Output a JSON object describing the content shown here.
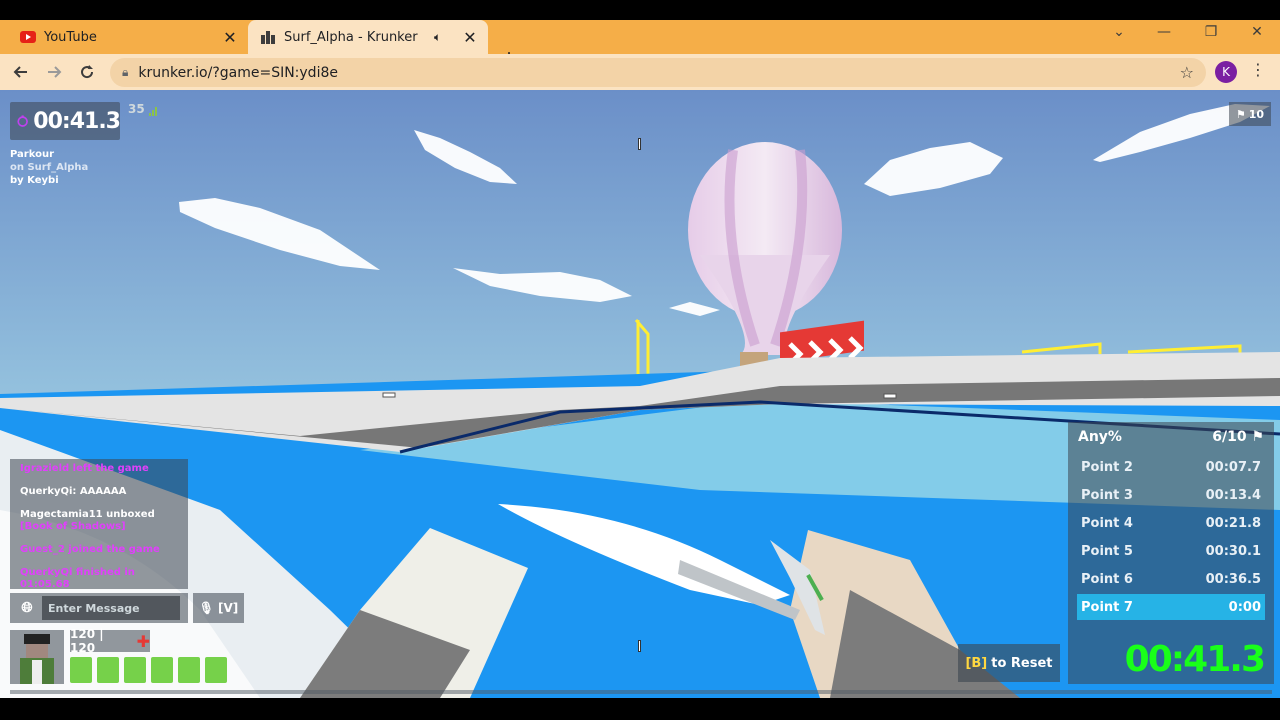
{
  "browser": {
    "tabs": [
      {
        "title": "YouTube",
        "icon": "youtube-icon"
      },
      {
        "title": "Surf_Alpha - Krunker",
        "icon": "krunker-icon",
        "active": true,
        "audio": "speaker-icon"
      }
    ],
    "new_tab_symbol": "+",
    "window_controls": {
      "dropdown": "⌄",
      "minimize": "—",
      "restore": "❐",
      "close": "✕"
    },
    "address": "krunker.io/?game=SIN:ydi8e",
    "profile_initial": "K",
    "colors": {
      "tabbar": "#f5ae48",
      "toolbar": "#fbe3c2",
      "profile": "#7b1fa2"
    }
  },
  "hud": {
    "timer": "00:41.3",
    "fps": "35",
    "mode": "Parkour",
    "map_line": "on Surf_Alpha",
    "author_line": "by Keybi",
    "flag_count": "10",
    "chat": [
      {
        "parts": [
          {
            "text": "Igrazield left the game",
            "color": "pink"
          }
        ]
      },
      {
        "parts": [
          {
            "text": "QuerkyQi: ",
            "color": "white"
          },
          {
            "text": "AAAAAA",
            "color": "white"
          }
        ]
      },
      {
        "parts": [
          {
            "text": "Magectamia11 unboxed ",
            "color": "white"
          },
          {
            "text": "[Book of Shadows]",
            "color": "pink"
          }
        ]
      },
      {
        "parts": [
          {
            "text": "Guest_2 joined the game",
            "color": "pink"
          }
        ]
      },
      {
        "parts": [
          {
            "text": "QuerkyQi finished in 01:05.68",
            "color": "pink"
          }
        ]
      }
    ],
    "chat_placeholder": "Enter Message",
    "voice_key": "[V]",
    "health": "120 | 120",
    "ammo_slots": 6,
    "splits_header": {
      "label": "Any%",
      "progress": "6/10"
    },
    "splits": [
      {
        "name": "Point 2",
        "time": "00:07.7"
      },
      {
        "name": "Point 3",
        "time": "00:13.4"
      },
      {
        "name": "Point 4",
        "time": "00:21.8"
      },
      {
        "name": "Point 5",
        "time": "00:30.1"
      },
      {
        "name": "Point 6",
        "time": "00:36.5"
      },
      {
        "name": "Point 7",
        "time": "0:00",
        "active": true
      }
    ],
    "big_timer": "00:41.3",
    "reset_key": "[B]",
    "reset_label": "to Reset",
    "colors": {
      "timer_green": "#19ff19",
      "active_split": "#26b3e6",
      "chat_pink": "#e040fb",
      "ammo": "#76d14a"
    }
  }
}
